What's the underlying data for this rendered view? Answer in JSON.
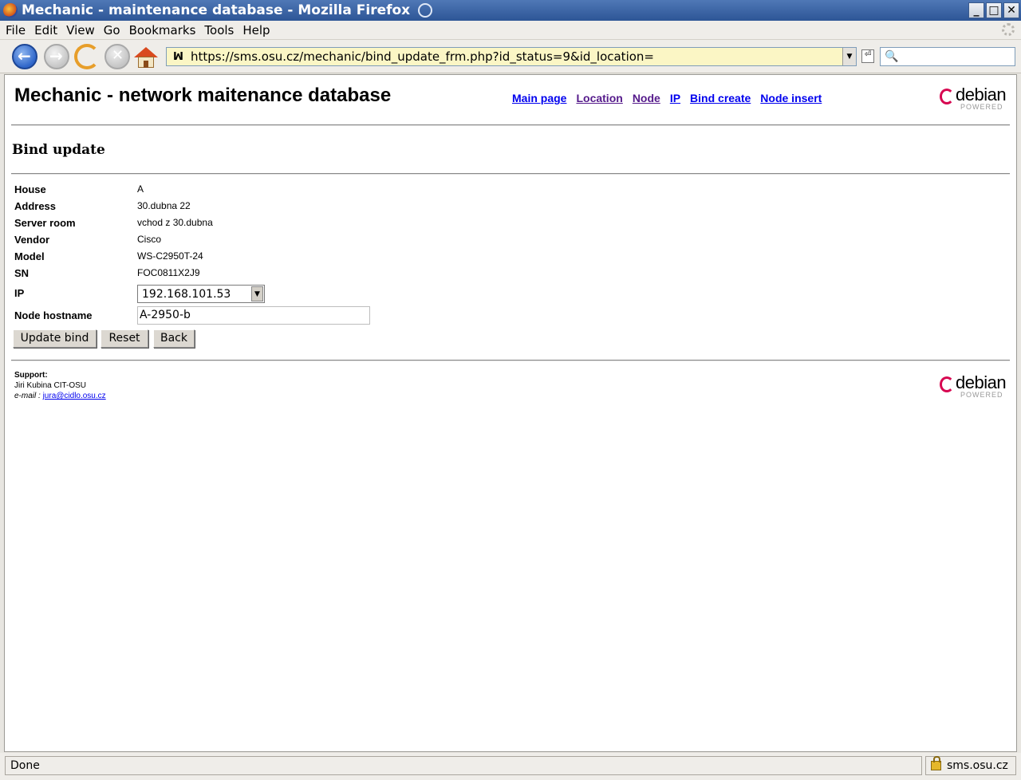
{
  "window": {
    "title": "Mechanic - maintenance database - Mozilla Firefox",
    "controls": {
      "minimize": "_",
      "maximize": "□",
      "close": "✕"
    }
  },
  "menu": {
    "items": [
      {
        "label": "File",
        "icon": ""
      },
      {
        "label": "Edit"
      },
      {
        "label": "View"
      },
      {
        "label": "Go"
      },
      {
        "label": "Bookmarks"
      },
      {
        "label": "Tools"
      },
      {
        "label": "Help"
      }
    ]
  },
  "toolbar": {
    "url": "https://sms.osu.cz/mechanic/bind_update_frm.php?id_status=9&id_location=",
    "url_icon": "ꟽ",
    "search_placeholder": ""
  },
  "page": {
    "site_title": "Mechanic - network maitenance database",
    "nav": [
      {
        "label": "Main page",
        "visited": false
      },
      {
        "label": "Location",
        "visited": true
      },
      {
        "label": "Node",
        "visited": true
      },
      {
        "label": "IP",
        "visited": false
      },
      {
        "label": "Bind create",
        "visited": false
      },
      {
        "label": "Node insert",
        "visited": false
      }
    ],
    "logo": {
      "word": "debian",
      "sub": "POWERED"
    },
    "heading": "Bind update",
    "fields": {
      "house": {
        "label": "House",
        "value": "A"
      },
      "address": {
        "label": "Address",
        "value": "30.dubna 22"
      },
      "server_room": {
        "label": "Server room",
        "value": "vchod z 30.dubna"
      },
      "vendor": {
        "label": "Vendor",
        "value": "Cisco"
      },
      "model": {
        "label": "Model",
        "value": "WS-C2950T-24"
      },
      "sn": {
        "label": "SN",
        "value": "FOC0811X2J9"
      },
      "ip": {
        "label": "IP",
        "selected": "192.168.101.53"
      },
      "hostname": {
        "label": "Node hostname",
        "value": "A-2950-b"
      }
    },
    "buttons": {
      "update": "Update bind",
      "reset": "Reset",
      "back": "Back"
    },
    "footer": {
      "support_label": "Support:",
      "name": "Jiri Kubina CIT-OSU",
      "email_label": "e-mail :",
      "email": "jura@cidlo.osu.cz"
    }
  },
  "status": {
    "text": "Done",
    "host": "sms.osu.cz"
  },
  "colors": {
    "link": "#0000ee",
    "visited": "#551a8b",
    "url_bg": "#fbf6c5",
    "debian_red": "#d70751"
  }
}
